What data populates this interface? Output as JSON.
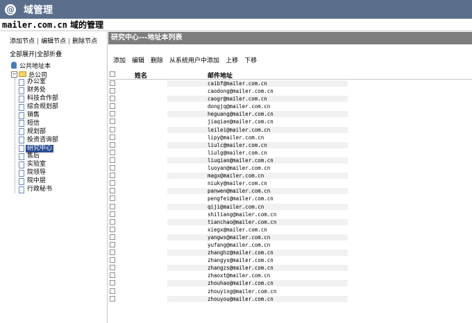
{
  "app": {
    "title": "域管理",
    "logo_glyph": "@"
  },
  "domain_bar": {
    "domain": "mailer.com.cn",
    "suffix": " 域的管理"
  },
  "sidebar": {
    "actions": [
      "添加节点",
      "编辑节点",
      "删除节点"
    ],
    "separator": "|",
    "actions2": [
      "全部展开",
      "全部折叠"
    ],
    "tree": {
      "root": "公共地址本",
      "group": "总公司",
      "nodes": [
        "办公室",
        "财务处",
        "科技合作部",
        "综合规划部",
        "销售",
        "短信",
        "规划部",
        "投资咨询部",
        "研究中心",
        "售后",
        "实验室",
        "院领导",
        "院中层",
        "行政秘书"
      ],
      "selected": "研究中心"
    }
  },
  "main": {
    "header": "研究中心---地址本列表",
    "toolbar": [
      "添加",
      "编辑",
      "删除",
      "从系统用户中添加",
      "上移",
      "下移"
    ],
    "columns": {
      "name": "姓名",
      "email": "邮件地址"
    },
    "emails": [
      "caibf@mailer.com.cn",
      "caodong@mailer.com.cn",
      "caogr@mailer.com.cn",
      "dongjq@mailer.com.cn",
      "heguang@mailer.com.cn",
      "jiaqian@mailer.com.cn",
      "leilei@mailer.com.cn",
      "lipy@mailer.com.cn",
      "liulc@mailer.com.cn",
      "liulg@mailer.com.cn",
      "liuqian@mailer.com.cn",
      "luoyan@mailer.com.cn",
      "magx@mailer.com.cn",
      "niuky@mailer.com.cn",
      "panwen@mailer.com.cn",
      "pengfei@mailer.com.cn",
      "qiji@mailer.com.cn",
      "shiliang@mailer.com.cn",
      "tianchao@mailer.com.cn",
      "xiegx@mailer.com.cn",
      "yangws@mailer.com.cn",
      "yufang@mailer.com.cn",
      "zhanghz@mailer.com.cn",
      "zhangys@mailer.com.cn",
      "zhangzs@mailer.com.cn",
      "zhaoxt@mailer.com.cn",
      "zhouhao@mailer.com.cn",
      "zhouying@mailer.com.cn",
      "zhouyou@mailer.com.cn"
    ]
  },
  "colors": {
    "titlebar": "#5b6f8c",
    "header": "#7d7d7d",
    "selected": "#2c4f94"
  }
}
